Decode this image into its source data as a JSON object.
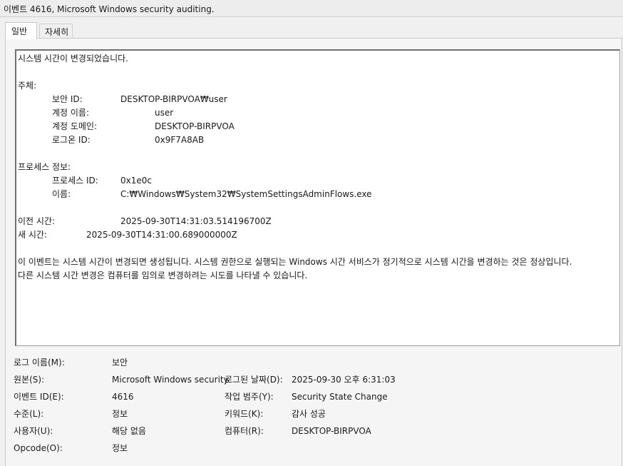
{
  "window": {
    "title": "이벤트 4616, Microsoft Windows security auditing."
  },
  "tabs": {
    "general": "일반",
    "details": "자세히"
  },
  "description": {
    "heading": "시스템 시간이 변경되었습니다.",
    "subject_header": "주체:",
    "security_id_label": "보안 ID:",
    "security_id_value": "DESKTOP-BIRPVOA₩user",
    "account_name_label": "계정 이름:",
    "account_name_value": "user",
    "account_domain_label": "계정 도메인:",
    "account_domain_value": "DESKTOP-BIRPVOA",
    "logon_id_label": "로그온 ID:",
    "logon_id_value": "0x9F7A8AB",
    "process_header": "프로세스 정보:",
    "process_id_label": "프로세스 ID:",
    "process_id_value": "0x1e0c",
    "process_name_label": "이름:",
    "process_name_value": "C:₩Windows₩System32₩SystemSettingsAdminFlows.exe",
    "previous_time_label": "이전 시간:",
    "previous_time_value": "2025-09-30T14:31:03.514196700Z",
    "new_time_label": "새 시간:",
    "new_time_value": "2025-09-30T14:31:00.689000000Z",
    "explanation_line1": "이 이벤트는 시스템 시간이 변경되면 생성됩니다. 시스템 권한으로 실행되는 Windows 시간 서비스가 정기적으로 시스템 시간을 변경하는 것은 정상입니다.",
    "explanation_line2": "다른 시스템 시간 변경은 컴퓨터를 임의로 변경하려는 시도를 나타낼 수 있습니다."
  },
  "properties": {
    "log_name_label": "로그 이름(M):",
    "log_name_value": "보안",
    "source_label": "원본(S):",
    "source_value": "Microsoft Windows security",
    "logged_label": "로그된 날짜(D):",
    "logged_value": "2025-09-30 오후 6:31:03",
    "event_id_label": "이벤트 ID(E):",
    "event_id_value": "4616",
    "task_category_label": "작업 범주(Y):",
    "task_category_value": "Security State Change",
    "level_label": "수준(L):",
    "level_value": "정보",
    "keywords_label": "키워드(K):",
    "keywords_value": "감사 성공",
    "user_label": "사용자(U):",
    "user_value": "해당 없음",
    "computer_label": "컴퓨터(R):",
    "computer_value": "DESKTOP-BIRPVOA",
    "opcode_label": "Opcode(O):",
    "opcode_value": "정보"
  }
}
